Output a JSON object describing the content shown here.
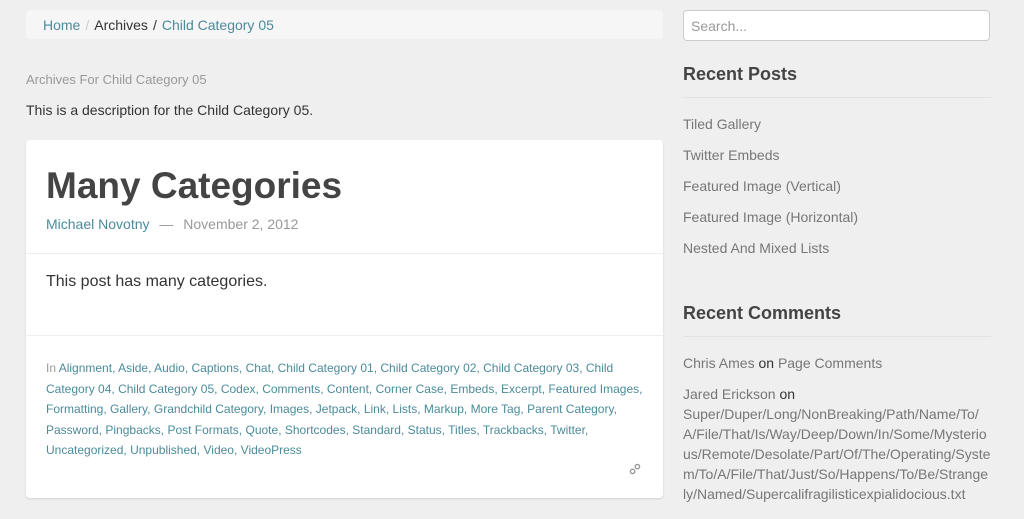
{
  "breadcrumb": {
    "home": "Home",
    "separator": "/",
    "archives": "Archives",
    "current": "Child Category 05"
  },
  "archive": {
    "title": "Archives For Child Category 05",
    "description": "This is a description for the Child Category 05."
  },
  "post": {
    "title": "Many Categories",
    "author": "Michael Novotny",
    "dash": "—",
    "date": "November 2, 2012",
    "content": "This post has many categories.",
    "categories_prefix": "In",
    "categories": [
      "Alignment",
      "Aside",
      "Audio",
      "Captions",
      "Chat",
      "Child Category 01",
      "Child Category 02",
      "Child Category 03",
      "Child Category 04",
      "Child Category 05",
      "Codex",
      "Comments",
      "Content",
      "Corner Case",
      "Embeds",
      "Excerpt",
      "Featured Images",
      "Formatting",
      "Gallery",
      "Grandchild Category",
      "Images",
      "Jetpack",
      "Link",
      "Lists",
      "Markup",
      "More Tag",
      "Parent Category",
      "Password",
      "Pingbacks",
      "Post Formats",
      "Quote",
      "Shortcodes",
      "Standard",
      "Status",
      "Titles",
      "Trackbacks",
      "Twitter",
      "Uncategorized",
      "Unpublished",
      "Video",
      "VideoPress"
    ],
    "permalink_icon": "link-icon"
  },
  "sidebar": {
    "search_placeholder": "Search...",
    "recent_posts": {
      "title": "Recent Posts",
      "items": [
        "Tiled Gallery",
        "Twitter Embeds",
        "Featured Image (Vertical)",
        "Featured Image (Horizontal)",
        "Nested And Mixed Lists"
      ]
    },
    "recent_comments": {
      "title": "Recent Comments",
      "on_label": "on",
      "items": [
        {
          "author": "Chris Ames",
          "post": "Page Comments"
        },
        {
          "author": "Jared Erickson",
          "post": "Super/Duper/Long/NonBreaking/Path/Name/To/A/File/That/Is/Way/Deep/Down/In/Some/Mysterious/Remote/Desolate/Part/Of/The/Operating/System/To/A/File/That/Just/So/Happens/To/Be/Strangely/Named/Supercalifragilisticexpialidocious.txt"
        }
      ]
    }
  },
  "colors": {
    "link": "#4b8b9b",
    "background": "#efefef",
    "card": "#ffffff",
    "muted": "#999999",
    "heading": "#444444"
  }
}
